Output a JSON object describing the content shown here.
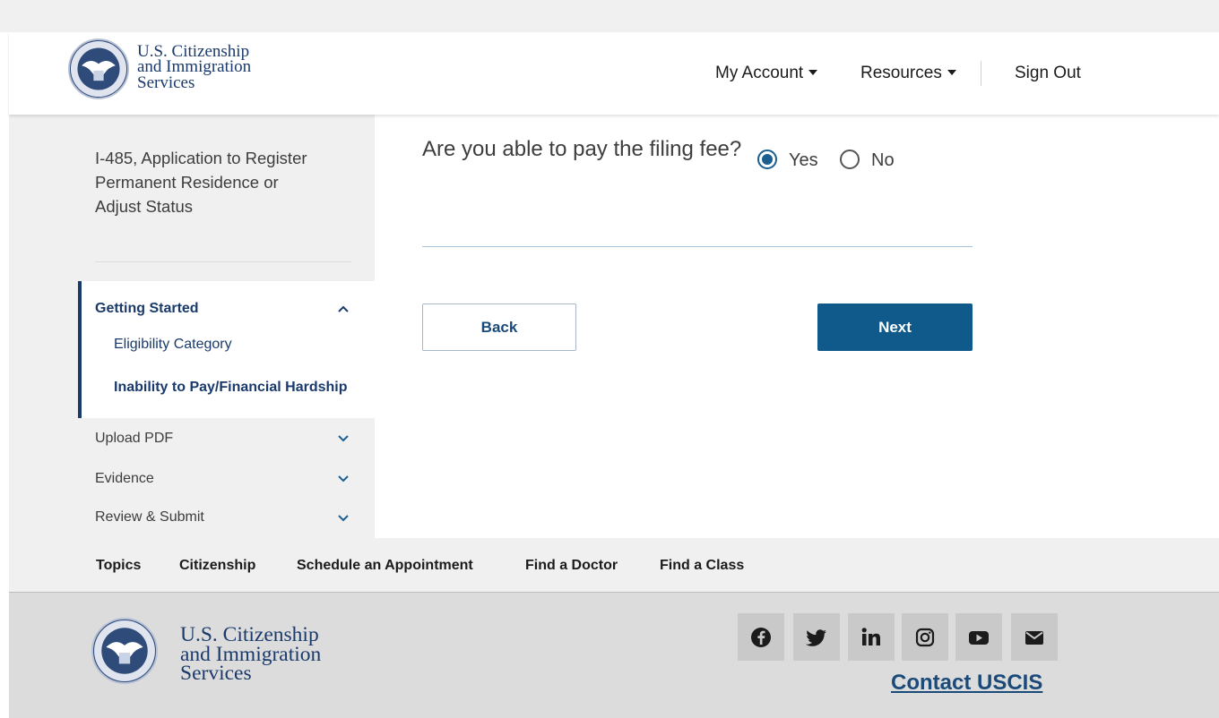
{
  "header": {
    "brand_line1": "U.S. Citizenship",
    "brand_line2": "and Immigration",
    "brand_line3": "Services",
    "nav": {
      "my_account": "My Account",
      "resources": "Resources",
      "sign_out": "Sign Out"
    }
  },
  "sidebar": {
    "form_title": "I-485, Application to Register Permanent Residence or Adjust Status",
    "sections": [
      {
        "label": "Getting Started",
        "expanded": true
      },
      {
        "label": "Upload PDF",
        "expanded": false
      },
      {
        "label": "Evidence",
        "expanded": false
      },
      {
        "label": "Review & Submit",
        "expanded": false
      }
    ],
    "sub_items": [
      {
        "label": "Eligibility Category",
        "current": false
      },
      {
        "label": "Inability to Pay/Financial Hardship",
        "current": true
      }
    ]
  },
  "main": {
    "question": "Are you able to pay the filing fee?",
    "options": [
      {
        "label": "Yes",
        "selected": true
      },
      {
        "label": "No",
        "selected": false
      }
    ],
    "back_label": "Back",
    "next_label": "Next"
  },
  "footer_nav": [
    "Topics",
    "Citizenship",
    "Schedule an Appointment",
    "Find a Doctor",
    "Find a Class"
  ],
  "footer": {
    "brand_line1": "U.S. Citizenship",
    "brand_line2": "and Immigration",
    "brand_line3": "Services",
    "social_icons": [
      "facebook-icon",
      "twitter-icon",
      "linkedin-icon",
      "instagram-icon",
      "youtube-icon",
      "email-icon"
    ],
    "contact_label": "Contact USCIS"
  },
  "colors": {
    "brand_navy": "#1a3a6b",
    "primary_button": "#0f5a8a",
    "sidebar_bg": "#f0f0f0",
    "footer_bg": "#dcdcdc"
  }
}
